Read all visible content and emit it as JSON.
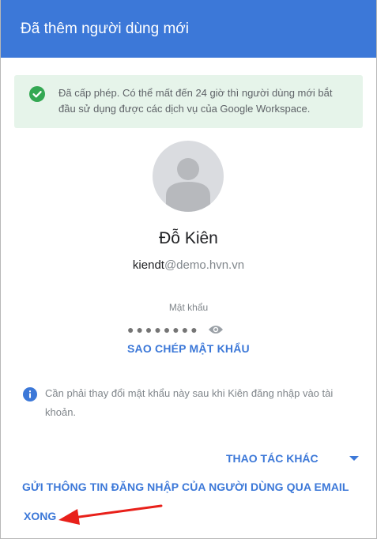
{
  "dialog": {
    "title": "Đã thêm người dùng mới"
  },
  "banner": {
    "text": "Đã cấp phép. Có thể mất đến 24 giờ thì người dùng mới bắt đầu sử dụng được các dịch vụ của Google Workspace.",
    "icon": "check-circle-icon",
    "color": "#34a853"
  },
  "user": {
    "name": "Đỗ Kiên",
    "email_user": "kiendt",
    "email_domain": "@demo.hvn.vn"
  },
  "password": {
    "label": "Mật khẩu",
    "masked": "●●●●●●●●",
    "copy_label": "SAO CHÉP MẬT KHẨU"
  },
  "info": {
    "text": "Cần phải thay đổi mật khẩu này sau khi Kiên đăng nhập vào tài khoản.",
    "icon": "info-icon"
  },
  "actions": {
    "more_label": "THAO TÁC KHÁC",
    "send_label": "GỬI THÔNG TIN ĐĂNG NHẬP CỦA NGƯỜI DÙNG QUA EMAIL",
    "done_label": "XONG"
  },
  "colors": {
    "header": "#3c78d8",
    "accent": "#3c78d8",
    "annotation_arrow": "#e8201a"
  }
}
